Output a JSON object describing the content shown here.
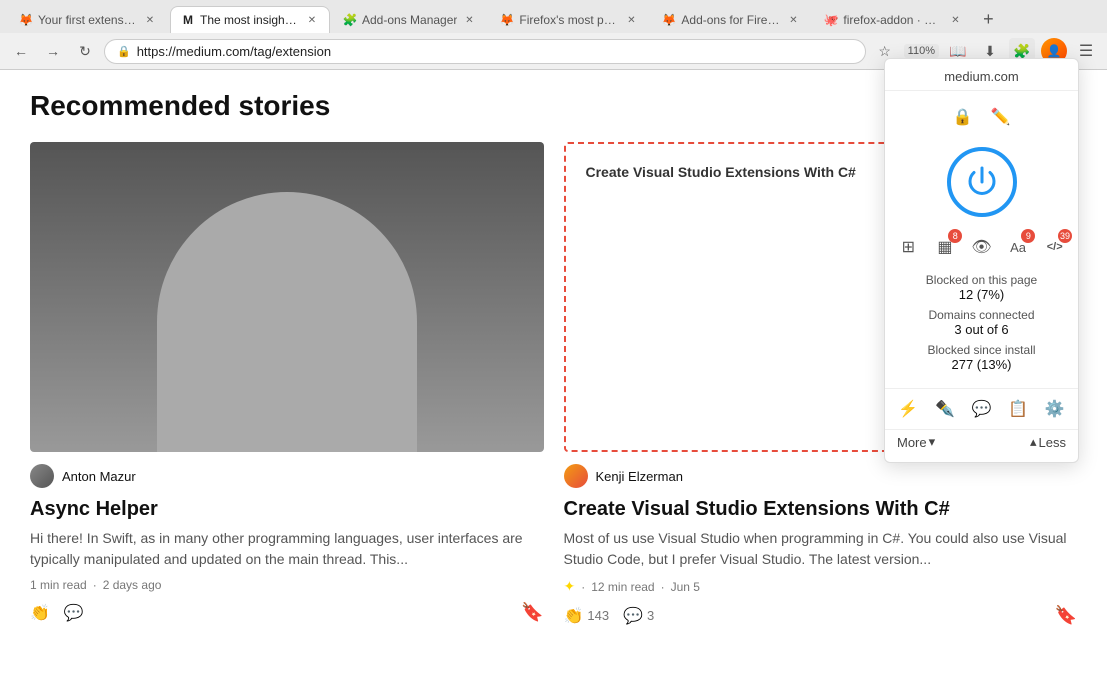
{
  "browser": {
    "tabs": [
      {
        "id": "tab1",
        "title": "Your first extension - Mozilla |",
        "favicon": "🦊",
        "active": false
      },
      {
        "id": "tab2",
        "title": "The most insightful stories ab...",
        "favicon": "M",
        "active": true
      },
      {
        "id": "tab3",
        "title": "Add-ons Manager",
        "favicon": "🧩",
        "active": false
      },
      {
        "id": "tab4",
        "title": "Firefox's most popular and inn...",
        "favicon": "🦊",
        "active": false
      },
      {
        "id": "tab5",
        "title": "Add-ons for Firefox (en-US)",
        "favicon": "🦊",
        "active": false
      },
      {
        "id": "tab6",
        "title": "firefox-addon · GitHub Topics",
        "favicon": "🐙",
        "active": false
      }
    ],
    "url": "https://medium.com/tag/extension",
    "zoom": "110%"
  },
  "page": {
    "title": "Recommended stories",
    "stories": [
      {
        "id": "story1",
        "author": "Anton Mazur",
        "title": "Async Helper",
        "excerpt": "Hi there! In Swift, as in many other programming languages, user interfaces are typically manipulated and updated on the main thread. This...",
        "read_time": "1 min read",
        "date": "2 days ago",
        "claps": "",
        "comments": "",
        "has_image": true
      },
      {
        "id": "story2",
        "author": "Kenji Elzerman",
        "title": "Create Visual Studio Extensions With C#",
        "excerpt": "Most of us use Visual Studio when programming in C#. You could also use Visual Studio Code, but I prefer Visual Studio. The latest version...",
        "read_time": "12 min read",
        "date": "Jun 5",
        "claps": "143",
        "comments": "3",
        "has_image": false,
        "image_text": "Create Visual Studio Extensions With C#"
      }
    ]
  },
  "extension_popup": {
    "domain": "medium.com",
    "stats": [
      {
        "label": "Blocked on this page",
        "value": "12 (7%)"
      },
      {
        "label": "Domains connected",
        "value": "3 out of 6"
      },
      {
        "label": "Blocked since install",
        "value": "277 (13%)"
      }
    ],
    "more_label": "More",
    "less_label": "Less"
  },
  "icons": {
    "lock": "🔒",
    "back": "←",
    "forward": "→",
    "reload": "↻",
    "star": "☆",
    "bookmark": "📖",
    "download": "⬇",
    "extension": "🧩",
    "menu": "☰",
    "close": "✕",
    "new_tab": "+",
    "clap": "👏",
    "comment": "💬",
    "save": "🔖",
    "chevron_down": "▾",
    "chevron_up": "▴",
    "power": "⏻",
    "lightning": "⚡",
    "pencil": "✏",
    "chat": "💬",
    "list": "☰",
    "gear": "⚙",
    "shield": "🛡",
    "eye_slash": "👁",
    "font": "Aa",
    "code": "</>",
    "pen_ext": "✒",
    "layers": "⊞"
  }
}
